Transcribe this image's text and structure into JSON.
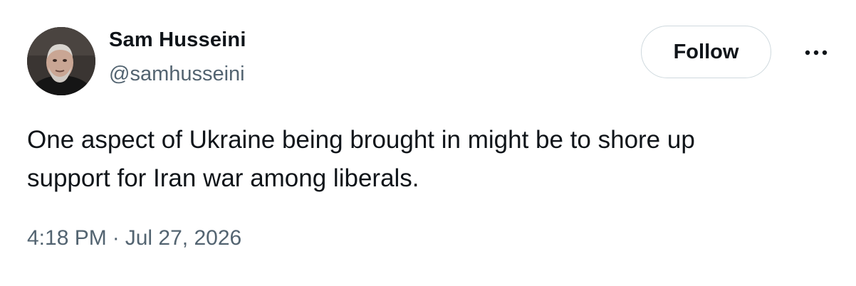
{
  "author": {
    "name": "Sam Husseini",
    "handle": "@samhusseini",
    "avatar_icon": "profile-photo"
  },
  "actions": {
    "follow_label": "Follow",
    "more_icon": "ellipsis-horizontal-icon"
  },
  "tweet": {
    "text": "One aspect of Ukraine being brought in might be to shore up\nsupport for Iran war among liberals.",
    "time": "4:18 PM",
    "separator": "·",
    "date": "Jul 27, 2026"
  },
  "colors": {
    "text_primary": "#0f1419",
    "text_secondary": "#536471",
    "border": "#cfd9de",
    "background": "#ffffff"
  }
}
